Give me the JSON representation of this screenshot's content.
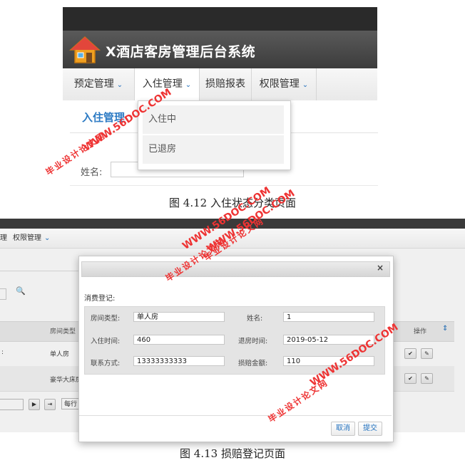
{
  "fig1": {
    "app_title": "X酒店客房管理后台系统",
    "nav": [
      {
        "label": "预定管理",
        "caret": "⌄"
      },
      {
        "label": "入住管理",
        "caret": "⌄"
      },
      {
        "label": "损赔报表",
        "caret": ""
      },
      {
        "label": "权限管理",
        "caret": "⌄"
      }
    ],
    "section_title": "入住管理",
    "dropdown": [
      "入住中",
      "已退房"
    ],
    "name_label": "姓名:",
    "caption": "图 4.12  入住状态分类页面"
  },
  "fig2": {
    "nav_partial": "理",
    "nav_item": "权限管理",
    "nav_caret": "⌄",
    "table_header_type": "房间类型",
    "table_header_ops": "操作",
    "rows": [
      {
        "prefix": ":",
        "type": "单人房"
      },
      {
        "prefix": "",
        "type": "豪华大床房"
      }
    ],
    "pager_per": "每行",
    "modal": {
      "close": "×",
      "section_label": "消费登记:",
      "fields": [
        {
          "label": "房间类型:",
          "value": "单人房"
        },
        {
          "label": "姓名:",
          "value": "1"
        },
        {
          "label": "入住时间:",
          "value": "460"
        },
        {
          "label": "退房时间:",
          "value": "2019-05-12"
        },
        {
          "label": "联系方式:",
          "value": "13333333333"
        },
        {
          "label": "损赔金额:",
          "value": "110"
        }
      ],
      "cancel_label": "取消",
      "submit_label": "提交"
    },
    "caption": "图 4.13  损赔登记页面"
  },
  "watermarks": [
    "WWW.56DOC.COM",
    "毕业设计论文网"
  ],
  "colors": {
    "accent": "#2d7bc4",
    "watermark": "#e33333"
  }
}
